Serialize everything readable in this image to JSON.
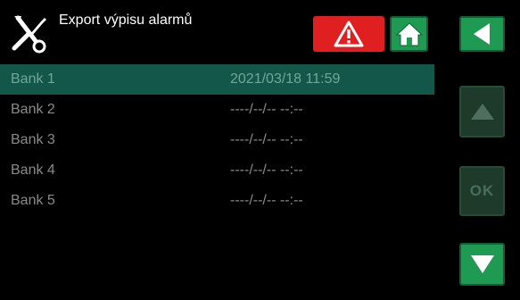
{
  "header": {
    "title": "Export výpisu alarmů",
    "ok_label": "OK"
  },
  "banks": [
    {
      "name": "Bank 1",
      "date": "2021/03/18 11:59",
      "selected": true
    },
    {
      "name": "Bank 2",
      "date": "----/--/-- --:--",
      "selected": false
    },
    {
      "name": "Bank 3",
      "date": "----/--/-- --:--",
      "selected": false
    },
    {
      "name": "Bank 4",
      "date": "----/--/-- --:--",
      "selected": false
    },
    {
      "name": "Bank 5",
      "date": "----/--/-- --:--",
      "selected": false
    }
  ],
  "icons": {
    "logo": "tools-icon",
    "alarm": "warning-icon",
    "home": "home-icon",
    "back": "back-arrow-icon",
    "up": "up-arrow-icon",
    "down": "down-arrow-icon"
  },
  "colors": {
    "background": "#000000",
    "selected_row": "#13564a",
    "alarm_red": "#e02020",
    "button_green": "#1e9a52",
    "button_disabled": "#1d3a2a"
  }
}
